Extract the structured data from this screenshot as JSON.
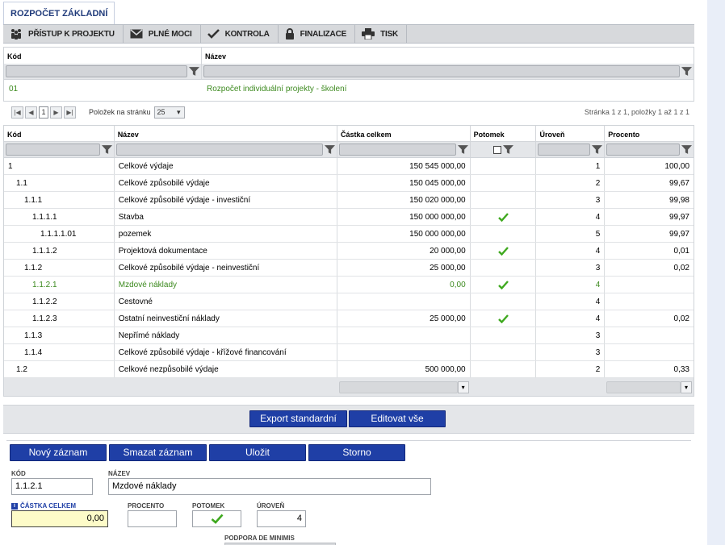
{
  "tab": {
    "label": "ROZPOČET ZÁKLADNÍ"
  },
  "toolbar": {
    "items": [
      {
        "label": "PŘÍSTUP K PROJEKTU",
        "icon": "people-icon"
      },
      {
        "label": "PLNÉ MOCI",
        "icon": "envelope-icon"
      },
      {
        "label": "KONTROLA",
        "icon": "checkmark-icon"
      },
      {
        "label": "FINALIZACE",
        "icon": "lock-icon"
      },
      {
        "label": "TISK",
        "icon": "printer-icon"
      }
    ]
  },
  "top_grid": {
    "col_kod": "Kód",
    "col_nazev": "Název",
    "row": {
      "kod": "01",
      "nazev": "Rozpočet individuální projekty - školení"
    }
  },
  "pager": {
    "current_page": "1",
    "per_page_label": "Položek na stránku",
    "per_page_value": "25",
    "info": "Stránka 1 z 1, položky 1 až 1 z 1"
  },
  "main_grid": {
    "headers": [
      "Kód",
      "Název",
      "Částka celkem",
      "Potomek",
      "Úroveň",
      "Procento"
    ],
    "rows": [
      {
        "kod": "1",
        "nazev": "Celkové výdaje",
        "castka": "150 545 000,00",
        "potomek": false,
        "uroven": "1",
        "procento": "100,00"
      },
      {
        "kod": "1.1",
        "nazev": "Celkové způsobilé výdaje",
        "castka": "150 045 000,00",
        "potomek": false,
        "uroven": "2",
        "procento": "99,67"
      },
      {
        "kod": "1.1.1",
        "nazev": "Celkové způsobilé výdaje - investiční",
        "castka": "150 020 000,00",
        "potomek": false,
        "uroven": "3",
        "procento": "99,98"
      },
      {
        "kod": "1.1.1.1",
        "nazev": "Stavba",
        "castka": "150 000 000,00",
        "potomek": true,
        "uroven": "4",
        "procento": "99,97"
      },
      {
        "kod": "1.1.1.1.01",
        "nazev": "pozemek",
        "castka": "150 000 000,00",
        "potomek": false,
        "uroven": "5",
        "procento": "99,97"
      },
      {
        "kod": "1.1.1.2",
        "nazev": "Projektová dokumentace",
        "castka": "20 000,00",
        "potomek": true,
        "uroven": "4",
        "procento": "0,01"
      },
      {
        "kod": "1.1.2",
        "nazev": "Celkové způsobilé výdaje - neinvestiční",
        "castka": "25 000,00",
        "potomek": false,
        "uroven": "3",
        "procento": "0,02"
      },
      {
        "kod": "1.1.2.1",
        "nazev": "Mzdové náklady",
        "castka": "0,00",
        "potomek": true,
        "uroven": "4",
        "procento": "",
        "selected": true
      },
      {
        "kod": "1.1.2.2",
        "nazev": "Cestovné",
        "castka": "",
        "potomek": false,
        "uroven": "4",
        "procento": ""
      },
      {
        "kod": "1.1.2.3",
        "nazev": "Ostatní neinvestiční náklady",
        "castka": "25 000,00",
        "potomek": true,
        "uroven": "4",
        "procento": "0,02"
      },
      {
        "kod": "1.1.3",
        "nazev": "Nepřímé náklady",
        "castka": "",
        "potomek": false,
        "uroven": "3",
        "procento": ""
      },
      {
        "kod": "1.1.4",
        "nazev": "Celkové způsobilé výdaje - křížové financování",
        "castka": "",
        "potomek": false,
        "uroven": "3",
        "procento": ""
      },
      {
        "kod": "1.2",
        "nazev": "Celkové nezpůsobilé výdaje",
        "castka": "500 000,00",
        "potomek": false,
        "uroven": "2",
        "procento": "0,33"
      }
    ]
  },
  "buttons": {
    "export": "Export standardní",
    "edit_all": "Editovat vše",
    "new": "Nový záznam",
    "delete": "Smazat záznam",
    "save": "Uložit",
    "cancel": "Storno"
  },
  "form": {
    "kod_label": "KÓD",
    "kod_value": "1.1.2.1",
    "nazev_label": "NÁZEV",
    "nazev_value": "Mzdové náklady",
    "castka_label": "ČÁSTKA CELKEM",
    "castka_value": "0,00",
    "procento_label": "PROCENTO",
    "procento_value": "",
    "potomek_label": "POTOMEK",
    "potomek_checked": true,
    "uroven_label": "ÚROVEŇ",
    "uroven_value": "4",
    "podpora_label": "PODPORA DE MINIMIS"
  },
  "colors": {
    "accent": "#1f3fa6",
    "green": "#3d8a1f",
    "required_bg": "#fdfbc8"
  }
}
